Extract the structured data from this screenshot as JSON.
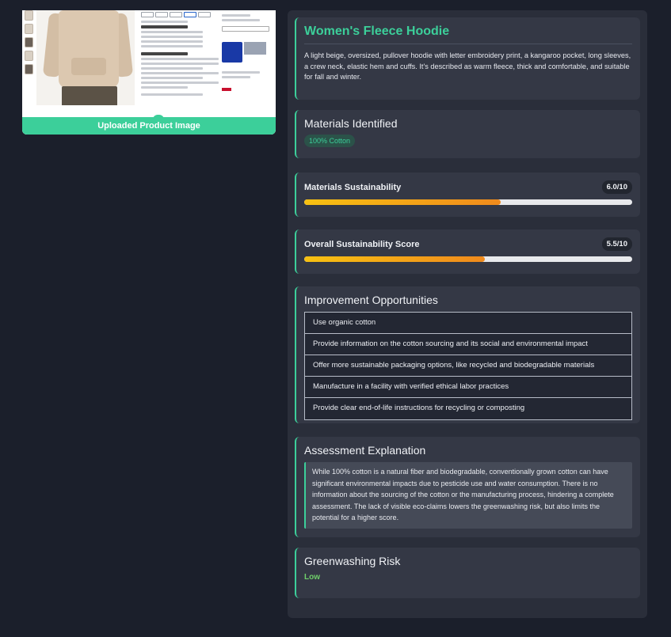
{
  "upload": {
    "caption": "Uploaded Product Image"
  },
  "product": {
    "title": "Women's Fleece Hoodie",
    "description": "A light beige, oversized, pullover hoodie with letter embroidery print, a kangaroo pocket, long sleeves, a crew neck, elastic hem and cuffs. It's described as warm fleece, thick and comfortable, and suitable for fall and winter."
  },
  "materials": {
    "title": "Materials Identified",
    "items": [
      "100% Cotton"
    ]
  },
  "scores": {
    "materials": {
      "label": "Materials Sustainability",
      "value_text": "6.0/10",
      "value": 6.0,
      "max": 10
    },
    "overall": {
      "label": "Overall Sustainability Score",
      "value_text": "5.5/10",
      "value": 5.5,
      "max": 10
    }
  },
  "improvements": {
    "title": "Improvement Opportunities",
    "items": [
      "Use organic cotton",
      "Provide information on the cotton sourcing and its social and environmental impact",
      "Offer more sustainable packaging options, like recycled and biodegradable materials",
      "Manufacture in a facility with verified ethical labor practices",
      "Provide clear end-of-life instructions for recycling or composting"
    ]
  },
  "explanation": {
    "title": "Assessment Explanation",
    "text": "While 100% cotton is a natural fiber and biodegradable, conventionally grown cotton can have significant environmental impacts due to pesticide use and water consumption. There is no information about the sourcing of the cotton or the manufacturing process, hindering a complete assessment. The lack of visible eco-claims lowers the greenwashing risk, but also limits the potential for a higher score."
  },
  "greenwashing": {
    "title": "Greenwashing Risk",
    "value": "Low"
  },
  "colors": {
    "accent": "#3ccf9a",
    "background": "#1b1f2b",
    "panel": "#2a2e3a",
    "card": "#343845",
    "bar_start": "#f7c112",
    "bar_end": "#f08a1c",
    "risk_low": "#6fcf6a"
  }
}
